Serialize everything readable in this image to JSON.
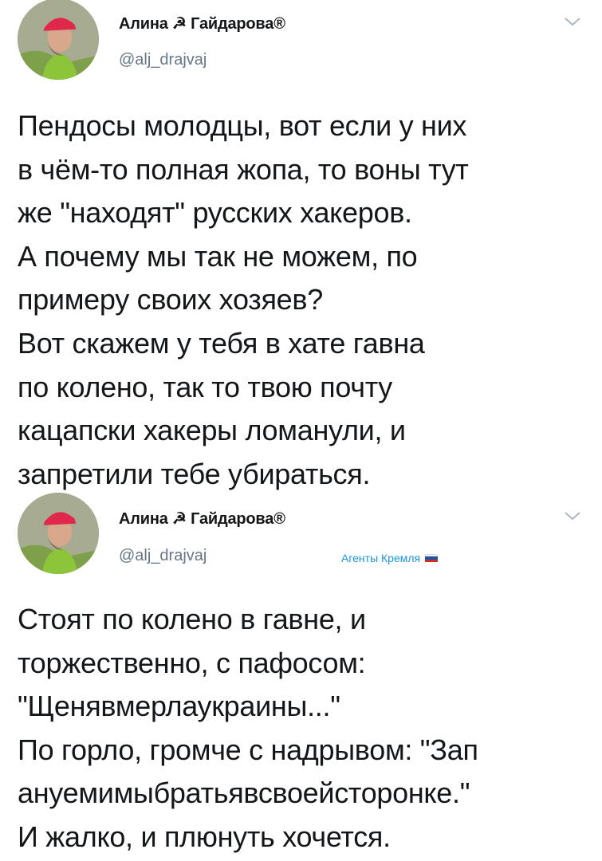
{
  "tweets": [
    {
      "author_name": "Алина ☭ Гайдарова®",
      "author_handle": "@alj_drajvaj",
      "tag": "",
      "text": "Пендосы молодцы, вот если у них\nв чём-то полная жопа, то воны тут\nже \"находят\" русских хакеров.\nА почему мы так не можем, по\nпримеру своих хозяев?\nВот скажем у тебя в хате гавна\nпо колено, так то твою почту\nкацапски хакеры ломанули, и\nзапретили тебе убираться."
    },
    {
      "author_name": "Алина ☭ Гайдарова®",
      "author_handle": "@alj_drajvaj",
      "tag": "Агенты Кремля",
      "text": "Стоят по колено в гавне, и\nторжественно, с пафосом:\n\"Щенявмерлаукраины...\"\nПо горло, громче с надрывом: \"Зап\nануемимыбратьявсвоейсторонке.\"\nИ жалко, и плюнуть хочется."
    }
  ],
  "colors": {
    "link": "#1b95e0",
    "muted": "#657786",
    "text": "#14171a"
  },
  "icons": {
    "menu": "chevron-down-icon",
    "avatar": "avatar-photo",
    "flag": "russia-flag-icon"
  }
}
